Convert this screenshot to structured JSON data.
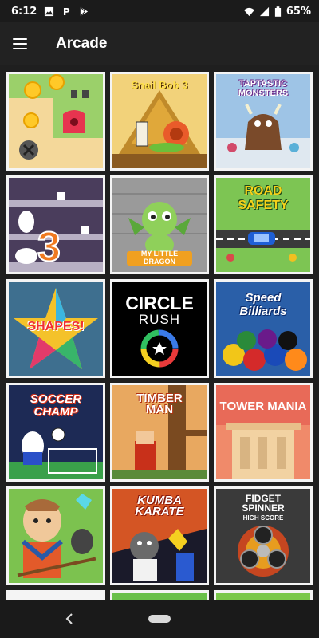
{
  "status_bar": {
    "time": "6:12",
    "battery": "65%"
  },
  "app_bar": {
    "title": "Arcade"
  },
  "games": [
    {
      "id": "coin-game",
      "title": "",
      "bg": "#9bd06a"
    },
    {
      "id": "snail-bob-3",
      "title": "Snail Bob 3",
      "bg": "#e8b64a"
    },
    {
      "id": "taptastic-monsters",
      "title": "TAPTASTIC MONSTERS",
      "bg": "#8fb4d6"
    },
    {
      "id": "cats-3",
      "title": "3",
      "bg": "#4a3d5c"
    },
    {
      "id": "my-little-dragon",
      "title": "MY LITTLE DRAGON",
      "bg": "#8c8c8c"
    },
    {
      "id": "road-safety",
      "title": "ROAD SAFETY",
      "bg": "#78c250"
    },
    {
      "id": "shapes",
      "title": "SHAPES!",
      "bg": "#3e6f8f"
    },
    {
      "id": "circle-rush",
      "title": "CIRCLE",
      "subtitle": "RUSH",
      "bg": "#000000"
    },
    {
      "id": "speed-billiards",
      "title": "Speed Billiards",
      "bg": "#2a5fa8"
    },
    {
      "id": "soccer-champ",
      "title": "SOCCER CHAMP",
      "bg": "#1d2a55"
    },
    {
      "id": "timber-man",
      "title": "TIMBER MAN",
      "bg": "#e5a15a"
    },
    {
      "id": "tower-mania",
      "title": "TOWER MANIA",
      "bg": "#e87860"
    },
    {
      "id": "farmer-game",
      "title": "",
      "bg": "#7bc24e"
    },
    {
      "id": "kumba-karate",
      "title": "KUMBA KARATE",
      "bg": "#d45524"
    },
    {
      "id": "fidget-spinner",
      "title": "FIDGET SPINNER",
      "subtitle": "HIGH SCORE",
      "bg": "#2a2a2a"
    }
  ],
  "icons": {
    "menu": "hamburger-icon",
    "back": "back-icon",
    "home": "home-icon"
  }
}
